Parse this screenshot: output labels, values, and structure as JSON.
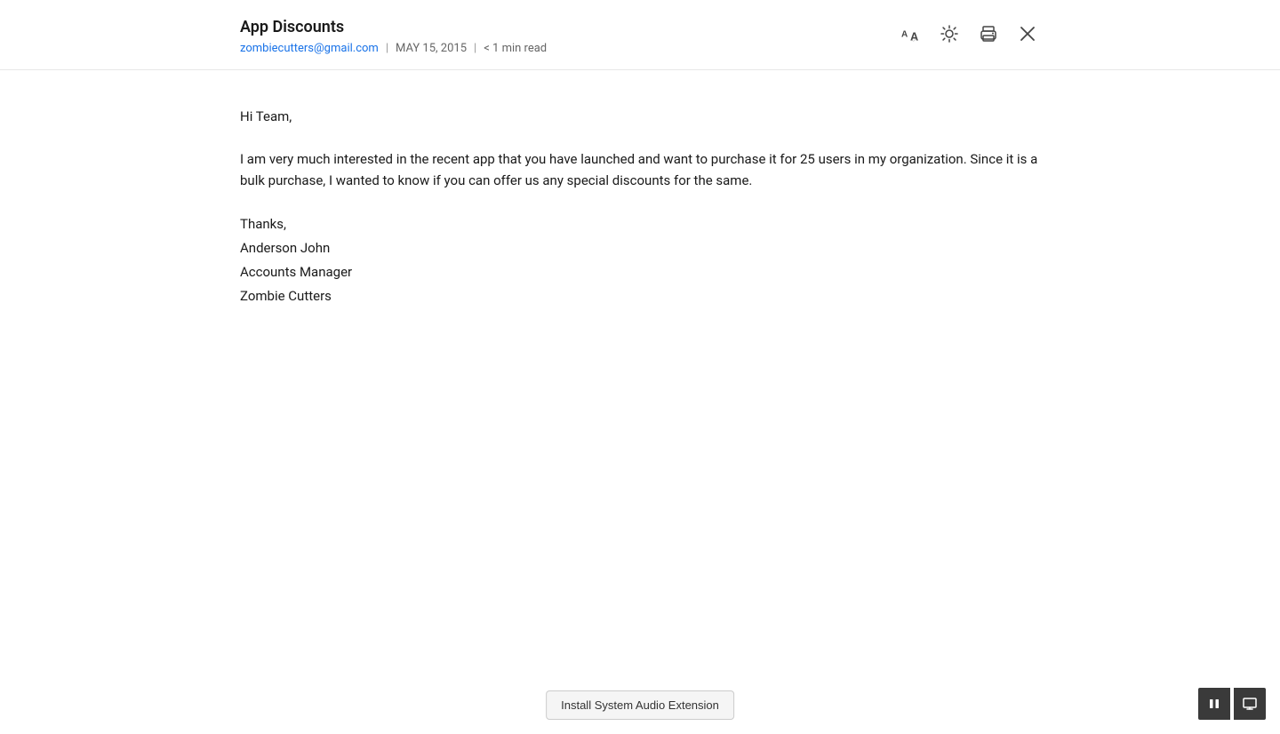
{
  "header": {
    "title": "App Discounts",
    "sender_email": "zombiecutters@gmail.com",
    "date": "MAY 15, 2015",
    "read_time": "< 1 min read",
    "separator": "|"
  },
  "toolbar": {
    "text_size_icon": "text-size-icon",
    "brightness_icon": "brightness-icon",
    "print_icon": "print-icon",
    "close_icon": "close-icon"
  },
  "body": {
    "greeting": "Hi Team,",
    "paragraph": "I am very much interested in the recent app that you have launched and want to purchase it for 25 users in my organization. Since it is a bulk purchase, I wanted to know if you can offer us any special discounts for the same.",
    "thanks": "Thanks,",
    "name": "Anderson John",
    "title": "Accounts Manager",
    "company": "Zombie Cutters"
  },
  "footer": {
    "install_button_label": "Install System Audio Extension"
  },
  "media_controls": {
    "pause_label": "pause",
    "screen_label": "screen"
  }
}
